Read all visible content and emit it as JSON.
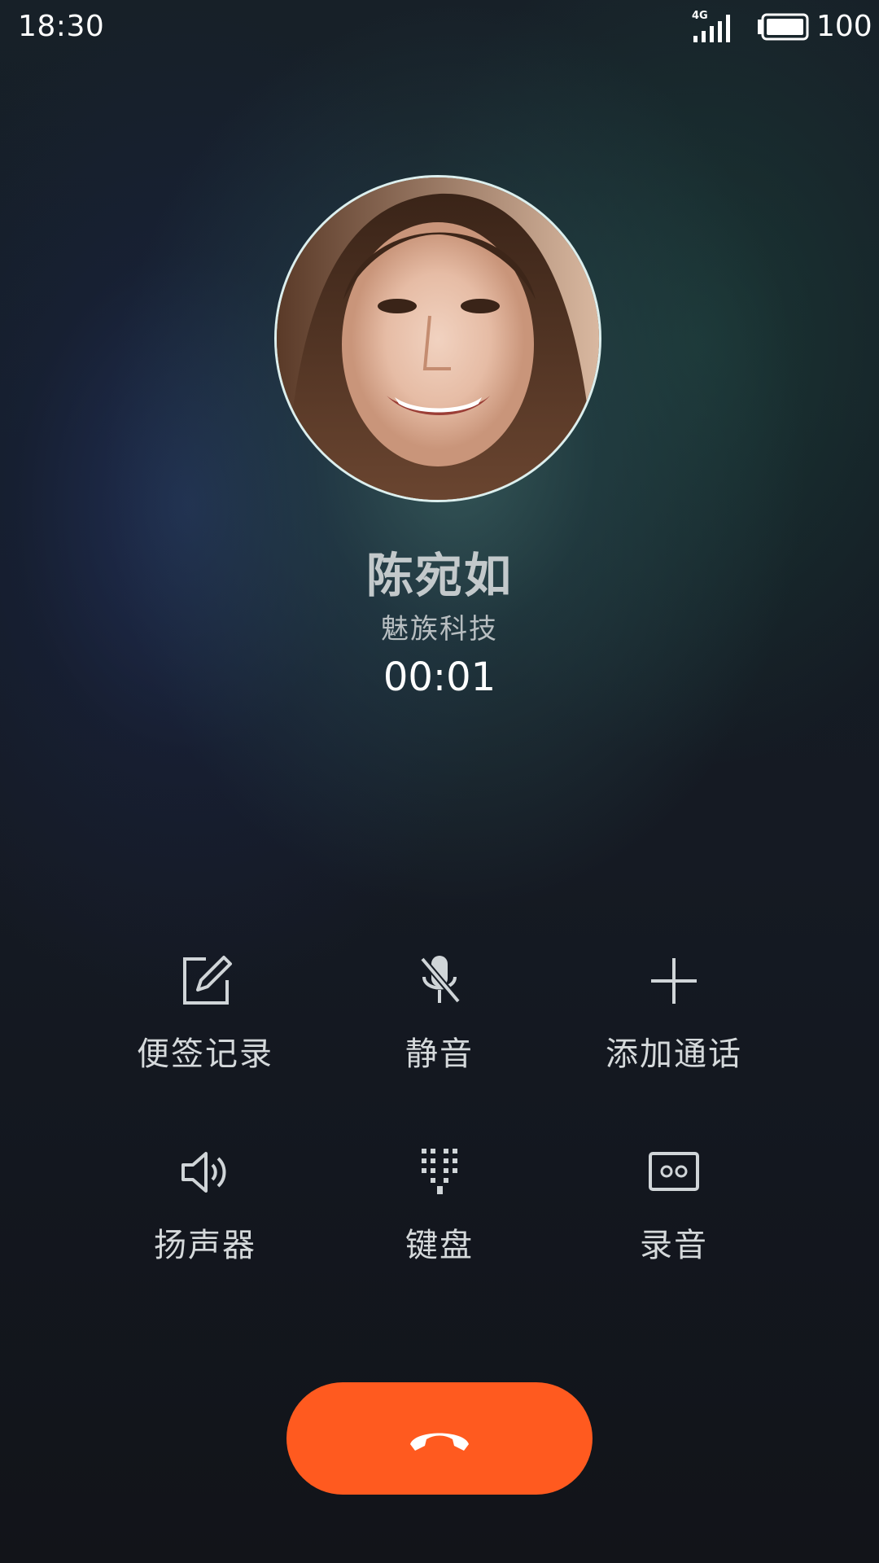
{
  "status_bar": {
    "time": "18:30",
    "network_type": "4G",
    "signal_icon": "signal-bars-icon",
    "battery_icon": "battery-icon",
    "battery_level": "100"
  },
  "contact": {
    "name": "陈宛如",
    "company": "魅族科技",
    "duration": "00:01",
    "avatar": "contact-avatar-photo"
  },
  "actions": [
    {
      "label": "便签记录",
      "icon": "note-edit-icon"
    },
    {
      "label": "静音",
      "icon": "microphone-muted-icon"
    },
    {
      "label": "添加通话",
      "icon": "plus-icon"
    },
    {
      "label": "扬声器",
      "icon": "speaker-icon"
    },
    {
      "label": "键盘",
      "icon": "dialpad-icon"
    },
    {
      "label": "录音",
      "icon": "record-icon"
    }
  ],
  "end_call": {
    "icon": "hang-up-icon",
    "color": "#ff5a1f"
  },
  "colors": {
    "accent": "#ff5a1f",
    "label_text": "#d5d9db",
    "icon_stroke": "#d0d5d8",
    "name_text": "#c3c9cb"
  }
}
